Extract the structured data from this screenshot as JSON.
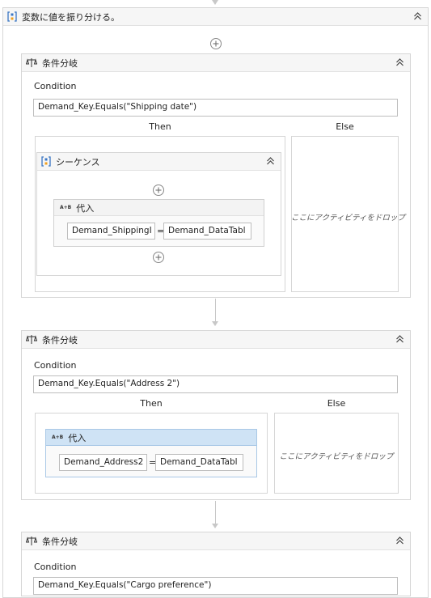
{
  "outer_sequence": {
    "title": "変数に値を振り分ける。"
  },
  "if_blocks": [
    {
      "title": "条件分岐",
      "condition_label": "Condition",
      "condition": "Demand_Key.Equals(\"Shipping date\")",
      "then_label": "Then",
      "else_label": "Else",
      "inner_sequence_title": "シーケンス",
      "assign": {
        "icon_text": "A+B",
        "title": "代入",
        "to": "Demand_ShippingI",
        "eq": "=",
        "value": "Demand_DataTabl"
      },
      "else_hint": "ここにアクティビティをドロップ"
    },
    {
      "title": "条件分岐",
      "condition_label": "Condition",
      "condition": "Demand_Key.Equals(\"Address 2\")",
      "then_label": "Then",
      "else_label": "Else",
      "assign": {
        "icon_text": "A+B",
        "title": "代入",
        "to": "Demand_Address2",
        "eq": "=",
        "value": "Demand_DataTabl"
      },
      "else_hint": "ここにアクティビティをドロップ"
    },
    {
      "title": "条件分岐",
      "condition_label": "Condition",
      "condition": "Demand_Key.Equals(\"Cargo preference\")"
    }
  ],
  "colors": {
    "selected_header": "#cfe3f5",
    "border": "#d6d6d6",
    "connector": "#c8c8c8"
  },
  "icons": {
    "sequence": "sequence-icon",
    "if": "if-icon",
    "collapse": "collapse-icon",
    "add": "add-icon",
    "assign": "assign-icon"
  }
}
